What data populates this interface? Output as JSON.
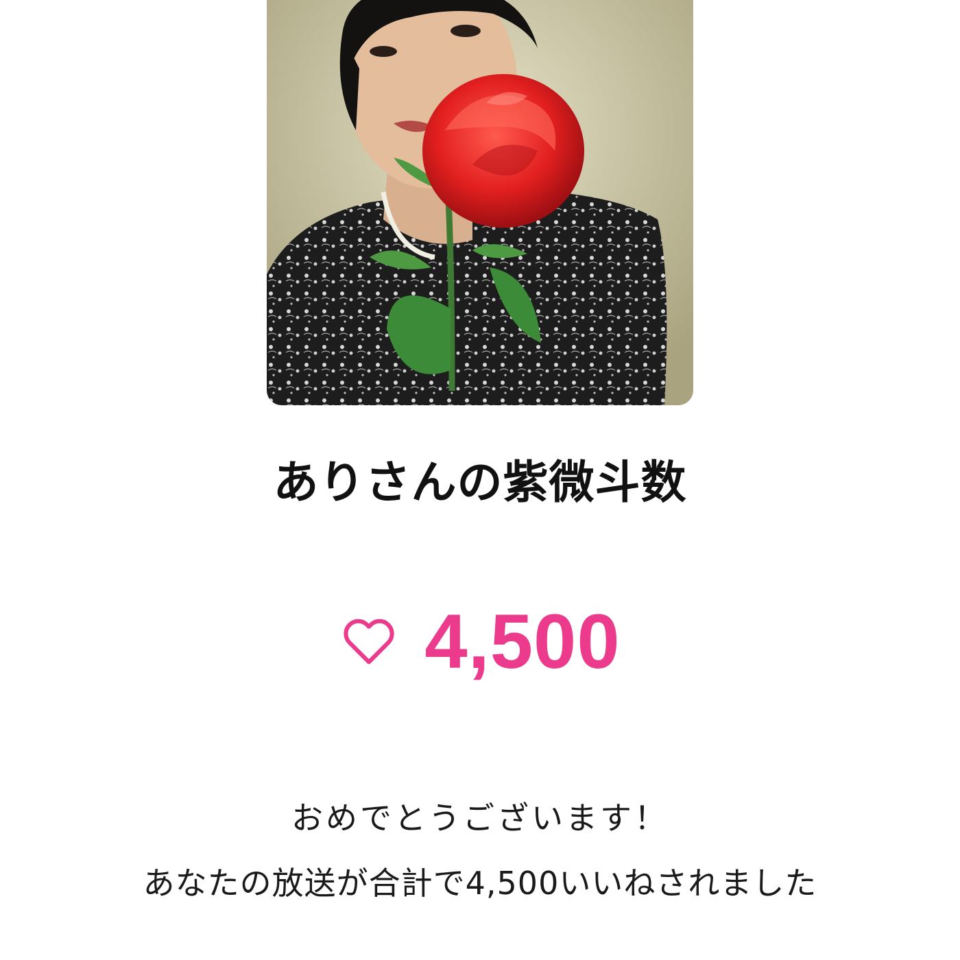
{
  "cover_image": {
    "icon": "profile-photo-with-red-rose"
  },
  "channel": {
    "title": "ありさんの紫微斗数"
  },
  "likes": {
    "icon": "heart-outline-icon",
    "count": "4,500",
    "accent_color": "#ec3b8c"
  },
  "message": {
    "line1": "おめでとうございます！",
    "line2": "あなたの放送が合計で4,500いいねされました"
  }
}
